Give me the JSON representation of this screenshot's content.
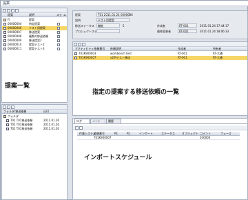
{
  "window": {
    "title": "提案"
  },
  "left_top": {
    "columns": [
      "提案",
      "説明",
      "ステ",
      "エ"
    ],
    "rows": [
      {
        "id": "Fi",
        "desc": "提案",
        "selected": false
      },
      {
        "id": "00000004",
        "desc": "特定提案",
        "selected": false
      },
      {
        "id": "00000006",
        "desc": "テスト用提案",
        "selected": true
      },
      {
        "id": "00000007",
        "desc": "移送提案",
        "selected": false
      },
      {
        "id": "00000008",
        "desc": "複数の移送依頼",
        "selected": false
      },
      {
        "id": "00000009",
        "desc": "移送提案2",
        "selected": false
      },
      {
        "id": "00000010",
        "desc": "提案テスト2",
        "selected": false
      },
      {
        "id": "00000011",
        "desc": "提案テスト3",
        "selected": false
      }
    ],
    "annotation": "提案一覧"
  },
  "left_bottom": {
    "columns": [
      "フォルダ/移送依頼",
      "日付"
    ],
    "rows": [
      {
        "id": "フォルダ",
        "date": ""
      },
      {
        "id": "T01 T01移送依頼",
        "date": "2011.01.26"
      },
      {
        "id": "T01 T01移送依頼",
        "date": "2011.01.26"
      },
      {
        "id": "T01 T01移送依頼",
        "date": "2011.01.26"
      }
    ]
  },
  "header": {
    "rows": [
      {
        "label": "提案",
        "value": "T01 2011.01.24 0000006"
      },
      {
        "label": "説明",
        "value": "テスト用提案"
      },
      {
        "label": "移送ステータス",
        "value": "機能",
        "num": "5",
        "right_label": "作成者",
        "right_value": "RT-001",
        "right_date": "2011.01.24 17:44:17"
      },
      {
        "label": "プロジェクトステータス",
        "value": "",
        "right_label": "最終変更者",
        "right_value": "RT-001",
        "right_date": "2011.01.24 18:06:33"
      }
    ]
  },
  "requests": {
    "columns": [
      "アクティビティ依頼番号",
      "依頼説明",
      "作成者",
      "所有者"
    ],
    "rows": [
      {
        "number": "T01K900003",
        "desc": "workbench test",
        "creator": "RT-001",
        "owner": "RT-大橋",
        "selected": false
      },
      {
        "number": "T01K900007",
        "desc": "v2/Rテスト移送",
        "creator": "RT-001",
        "owner": "RT-大橋",
        "selected": true
      }
    ],
    "annotation": "指定の提案する移送依頼の一覧"
  },
  "bottom": {
    "tabs": [
      "ログ",
      "ノート",
      "履歴"
    ],
    "columns": [
      "",
      "作業システム",
      "依頼番号",
      "RC",
      "RC",
      "インポート",
      "ステータス",
      "オブジェクト",
      "コメント",
      "フェーズ"
    ],
    "row": {
      "number": "T01K900007",
      "status": "200000"
    },
    "annotation": "インポートスケジュール"
  }
}
